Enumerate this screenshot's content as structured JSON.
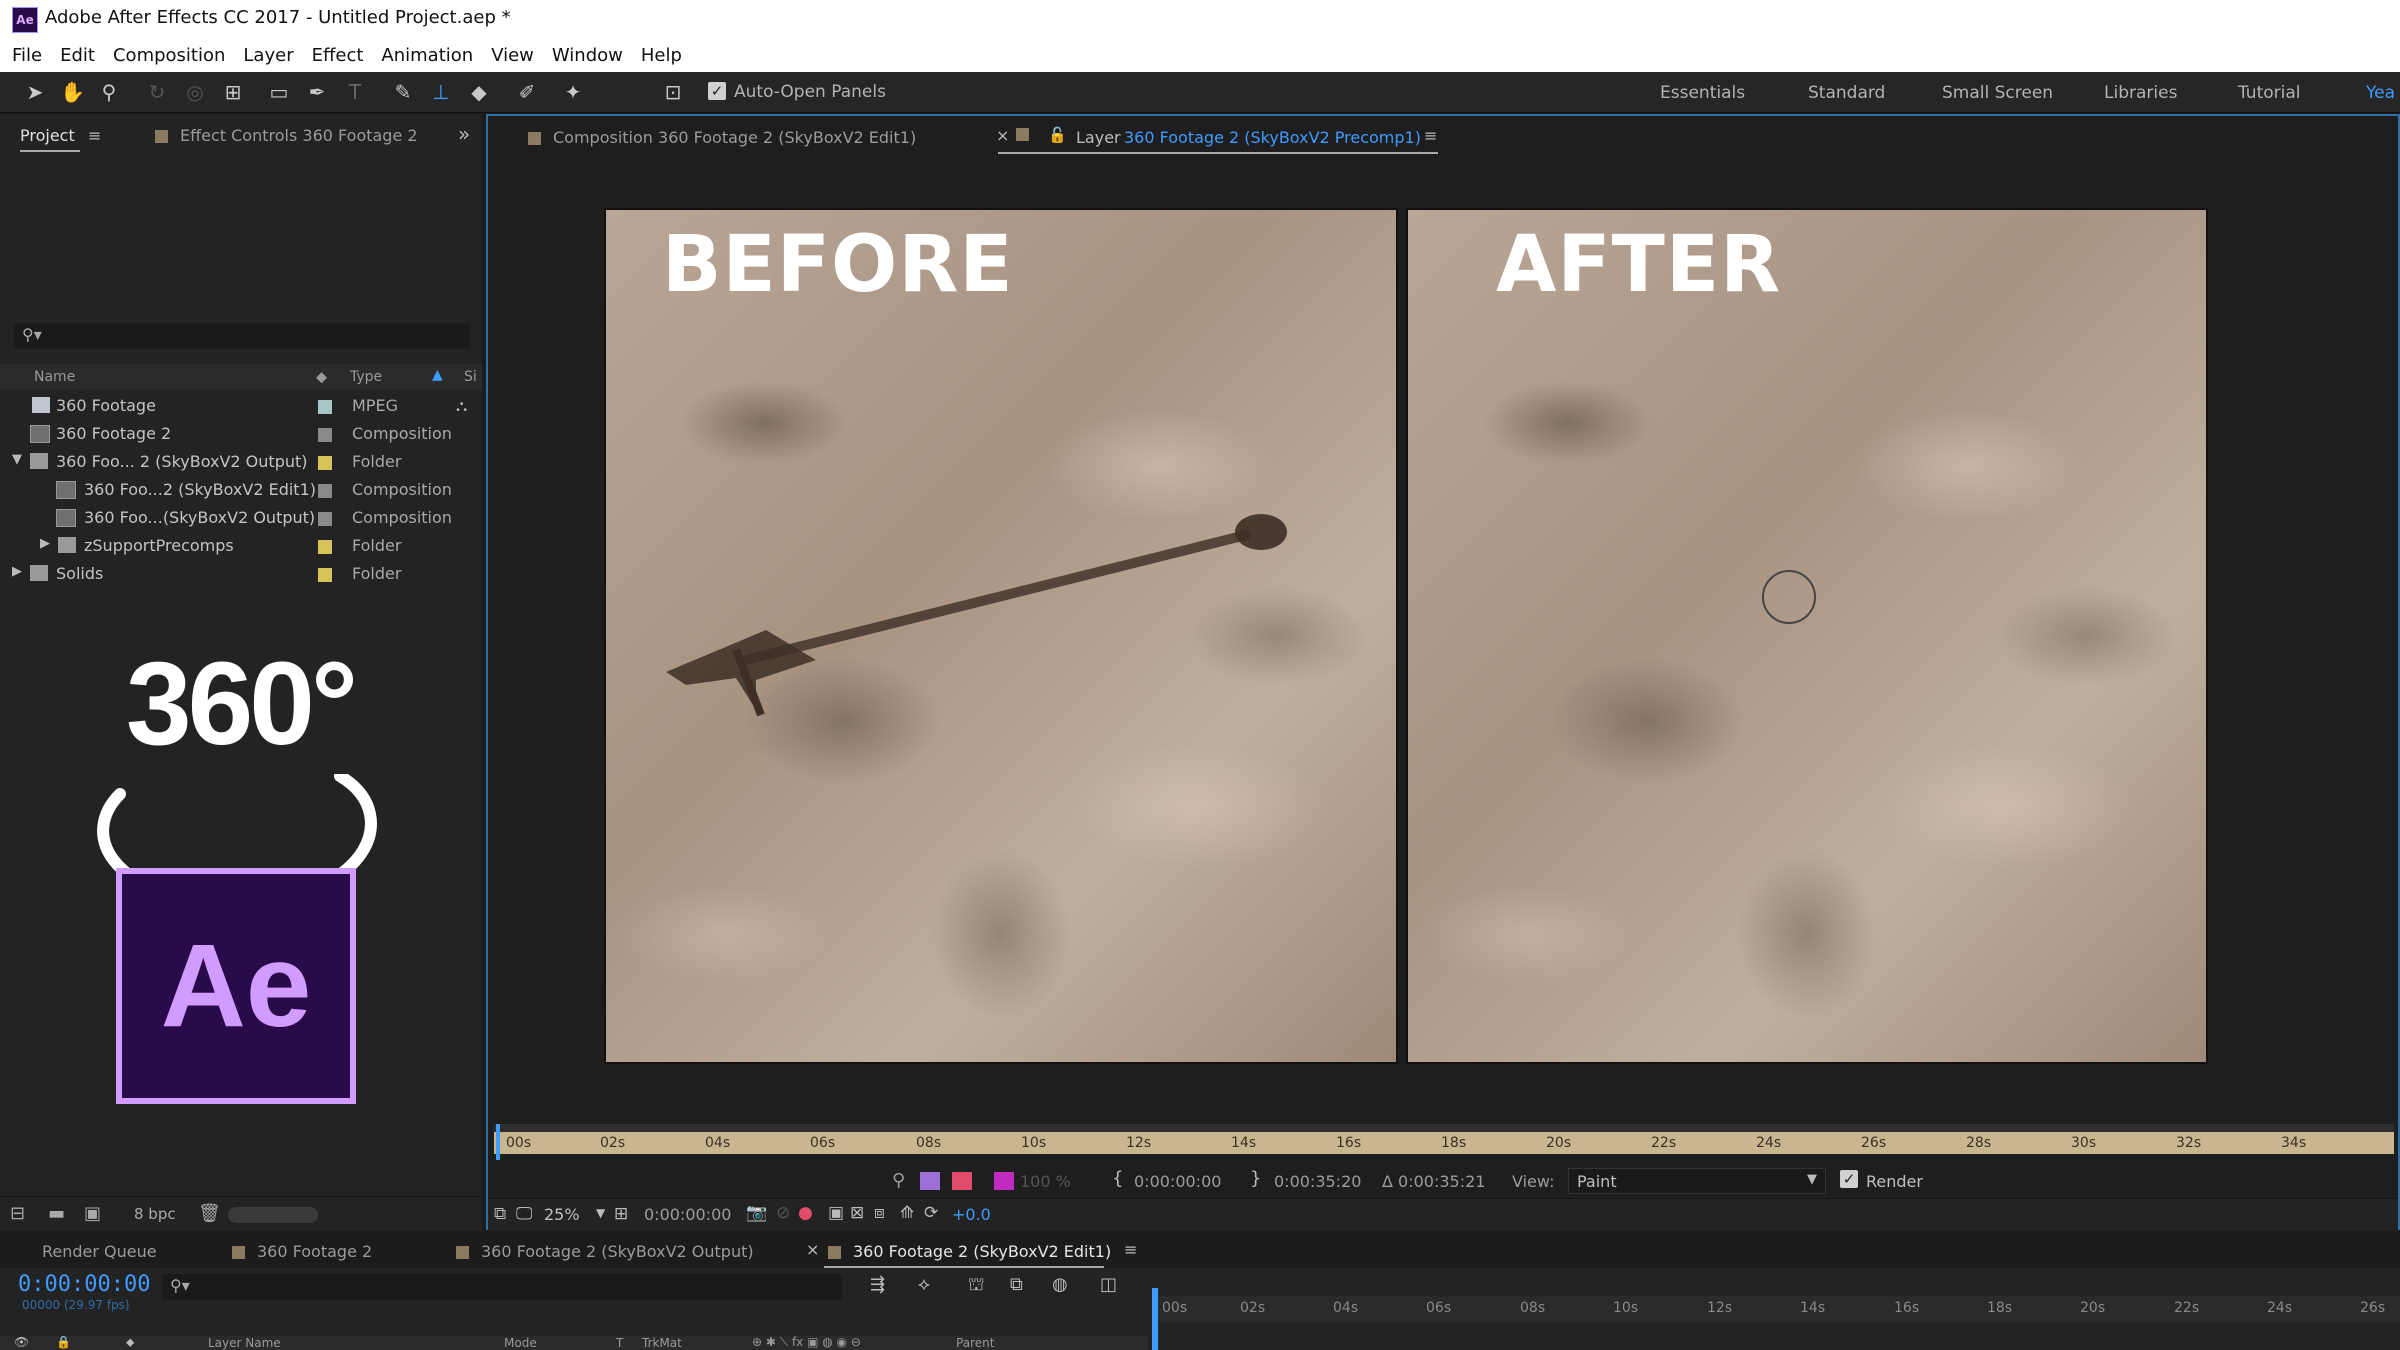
{
  "window": {
    "title": "Adobe After Effects CC 2017 - Untitled Project.aep *",
    "app_icon": "Ae"
  },
  "menu": [
    "File",
    "Edit",
    "Composition",
    "Layer",
    "Effect",
    "Animation",
    "View",
    "Window",
    "Help"
  ],
  "toolbar": {
    "auto_open_panels": "Auto-Open Panels",
    "workspaces": [
      "Essentials",
      "Standard",
      "Small Screen",
      "Libraries",
      "Tutorial",
      "Yea"
    ]
  },
  "project_panel": {
    "tab_project": "Project",
    "tab_effect_controls": "Effect Controls 360 Footage 2",
    "col_name": "Name",
    "col_type": "Type",
    "col_size": "Si",
    "items": [
      {
        "name": "360 Footage",
        "type": "MPEG",
        "label_color": "#a7c6c6"
      },
      {
        "name": "360 Footage 2",
        "type": "Composition",
        "label_color": "#8a8a8a"
      },
      {
        "name": "360 Foo... 2 (SkyBoxV2 Output)",
        "type": "Folder",
        "label_color": "#d8c25a"
      },
      {
        "name": "360 Foo...2 (SkyBoxV2 Edit1)",
        "type": "Composition",
        "label_color": "#8a8a8a"
      },
      {
        "name": "360 Foo...(SkyBoxV2 Output)",
        "type": "Composition",
        "label_color": "#8a8a8a"
      },
      {
        "name": "zSupportPrecomps",
        "type": "Folder",
        "label_color": "#d8c25a"
      },
      {
        "name": "Solids",
        "type": "Folder",
        "label_color": "#d8c25a"
      }
    ],
    "overlay_360": "360°",
    "ae_logo": "Ae",
    "bpc": "8 bpc"
  },
  "viewer": {
    "tab_composition": "Composition 360 Footage 2 (SkyBoxV2 Edit1)",
    "tab_layer_prefix": "Layer",
    "tab_layer_name": "360 Footage 2 (SkyBoxV2 Precomp1)",
    "before_label": "BEFORE",
    "after_label": "AFTER",
    "ruler_ticks": [
      "00s",
      "02s",
      "04s",
      "06s",
      "08s",
      "10s",
      "12s",
      "14s",
      "16s",
      "18s",
      "20s",
      "22s",
      "24s",
      "26s",
      "28s",
      "30s",
      "32s",
      "34s"
    ],
    "opacity": "100 %",
    "in_time": "0:00:00:00",
    "out_time": "0:00:35:20",
    "duration": "Δ 0:00:35:21",
    "view_label": "View:",
    "view_value": "Paint",
    "render_label": "Render",
    "zoom": "25%",
    "current_time": "0:00:00:00",
    "exposure": "+0.0"
  },
  "timeline": {
    "tabs": [
      "Render Queue",
      "360 Footage 2",
      "360 Footage 2 (SkyBoxV2 Output)",
      "360 Footage 2 (SkyBoxV2 Edit1)"
    ],
    "timecode": "0:00:00:00",
    "frame_info": "00000 (29.97 fps)",
    "ruler_ticks": [
      "00s",
      "02s",
      "04s",
      "06s",
      "08s",
      "10s",
      "12s",
      "14s",
      "16s",
      "18s",
      "20s",
      "22s",
      "24s",
      "26s"
    ],
    "columns": [
      "Layer Name",
      "Mode",
      "T",
      "TrkMat",
      "Parent"
    ]
  },
  "colors": {
    "accent": "#3e9bff",
    "ae_purple": "#9999ff",
    "ae_bg": "#2a0b4a"
  }
}
